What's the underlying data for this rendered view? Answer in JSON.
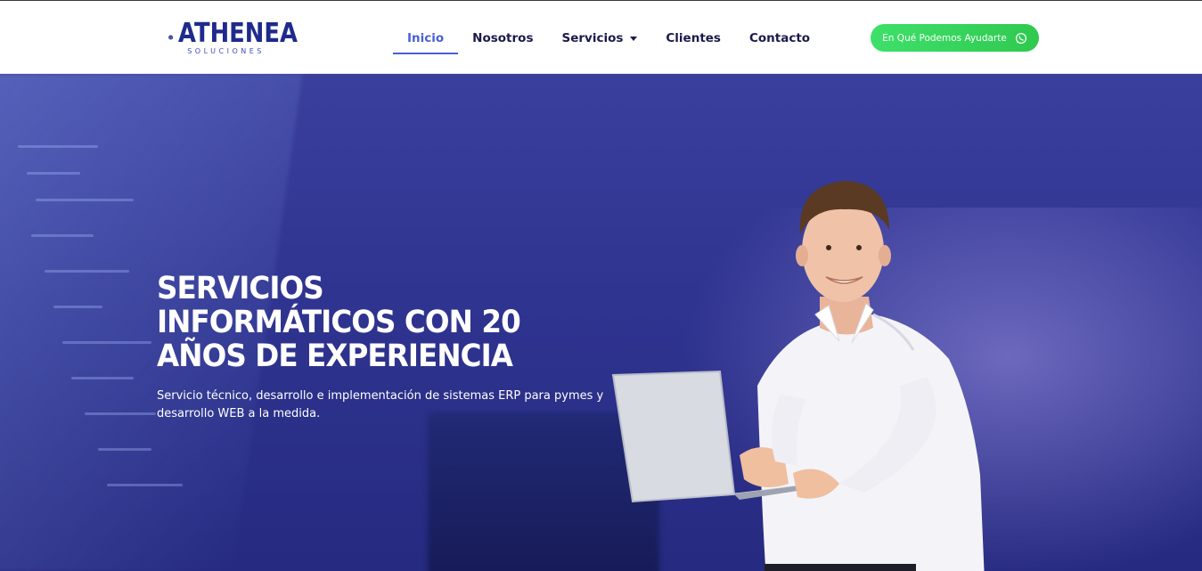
{
  "header": {
    "logo": {
      "name": "ATHENEA",
      "subtitle": "SOLUCIONES",
      "icon": "globe-icon"
    },
    "nav": [
      {
        "label": "Inicio",
        "active": true
      },
      {
        "label": "Nosotros",
        "active": false
      },
      {
        "label": "Servicios",
        "active": false,
        "has_dropdown": true
      },
      {
        "label": "Clientes",
        "active": false
      },
      {
        "label": "Contacto",
        "active": false
      }
    ],
    "cta": {
      "label": "En Qué Podemos Ayudarte",
      "icon": "whatsapp-icon"
    }
  },
  "hero": {
    "title_lines": [
      "SERVICIOS",
      "INFORMÁTICOS CON 20",
      "AÑOS DE EXPERIENCIA"
    ],
    "subtitle_lines": [
      "Servicio técnico, desarrollo e implementación de sistemas ERP para pymes y",
      "desarrollo WEB a la medida."
    ]
  },
  "colors": {
    "brand": "#1f2a8c",
    "nav_active": "#4a5fd8",
    "cta_green": "#3ee06a",
    "hero_bg": "#2f3490"
  }
}
